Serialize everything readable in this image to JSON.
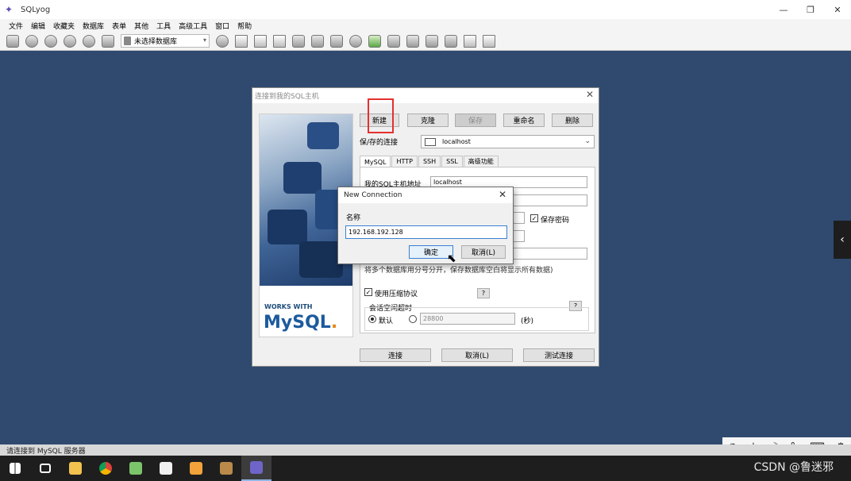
{
  "app": {
    "title": "SQLyog"
  },
  "window_controls": {
    "minimize": "—",
    "restore": "❐",
    "close": "✕"
  },
  "menu": [
    "文件",
    "编辑",
    "收藏夹",
    "数据库",
    "表单",
    "其他",
    "工具",
    "高级工具",
    "窗口",
    "帮助"
  ],
  "toolbar": {
    "db_select": "未选择数据库"
  },
  "status": {
    "text": "请连接到 MySQL 服务器"
  },
  "dialog": {
    "title": "连接到我的SQL主机",
    "buttons": {
      "new": "新建",
      "clone": "克隆",
      "save": "保存",
      "rename": "重命名",
      "delete": "删除"
    },
    "saved_conn_label": "保/存的连接",
    "saved_conn_value": "localhost",
    "tabs": [
      "MySQL",
      "HTTP",
      "SSH",
      "SSL",
      "高级功能"
    ],
    "host_label": "我的SQL主机地址",
    "host_value": "localhost",
    "save_password": "保存密码",
    "db_hint": "将多个数据库用分号分开，保存数据库空白将显示所有数据)",
    "compression": "使用压缩协议",
    "help": "?",
    "session_timeout": "会话空闲超时",
    "default": "默认",
    "timeout_value": "28800",
    "seconds": "(秒)",
    "connect": "连接",
    "cancel": "取消(L)",
    "test": "测试连接",
    "brand": {
      "works_with": "WORKS WITH",
      "mysql": "MySQL",
      "dot": "."
    }
  },
  "new_connection": {
    "title": "New Connection",
    "name_label": "名称",
    "name_value": "192.168.192.128",
    "ok": "确定",
    "cancel": "取消(L)"
  },
  "ime": [
    "中",
    "☽",
    "°,",
    "⌨",
    "⚙"
  ],
  "watermark": "CSDN @鲁迷邪",
  "colors": {
    "highlight": "#e53030",
    "desktop": "#2f4a6e",
    "focus": "#3c7fd1"
  }
}
